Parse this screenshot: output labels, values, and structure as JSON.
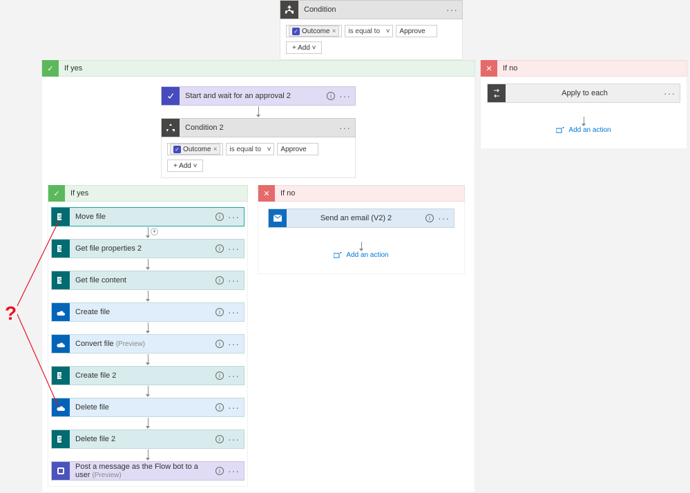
{
  "annotation": {
    "question_mark": "?"
  },
  "condition_top": {
    "title": "Condition",
    "token_label": "Outcome",
    "operator": "is equal to",
    "value": "Approve",
    "add_label": "+ Add"
  },
  "branch_yes1": {
    "header": "If yes",
    "approval": {
      "title": "Start and wait for an approval 2"
    },
    "condition2": {
      "title": "Condition 2",
      "token_label": "Outcome",
      "operator": "is equal to",
      "value": "Approve",
      "add_label": "+ Add"
    },
    "branch_yes2": {
      "header": "If yes",
      "steps": [
        {
          "title": "Move file",
          "icon": "teal"
        },
        {
          "title": "Get file properties 2",
          "icon": "teal"
        },
        {
          "title": "Get file content",
          "icon": "teal"
        },
        {
          "title": "Create file",
          "icon": "cloud"
        },
        {
          "title": "Convert file",
          "icon": "cloud",
          "suffix": "(Preview)"
        },
        {
          "title": "Create file 2",
          "icon": "teal"
        },
        {
          "title": "Delete file",
          "icon": "cloud"
        },
        {
          "title": "Delete file 2",
          "icon": "teal"
        },
        {
          "title": "Post a message as the Flow bot to a user",
          "icon": "tpurp",
          "suffix": "(Preview)"
        }
      ]
    },
    "branch_no2": {
      "header": "If no",
      "email": {
        "title": "Send an email (V2) 2"
      },
      "add_action": "Add an action"
    }
  },
  "branch_no1": {
    "header": "If no",
    "apply": {
      "title": "Apply to each"
    },
    "add_action": "Add an action"
  }
}
